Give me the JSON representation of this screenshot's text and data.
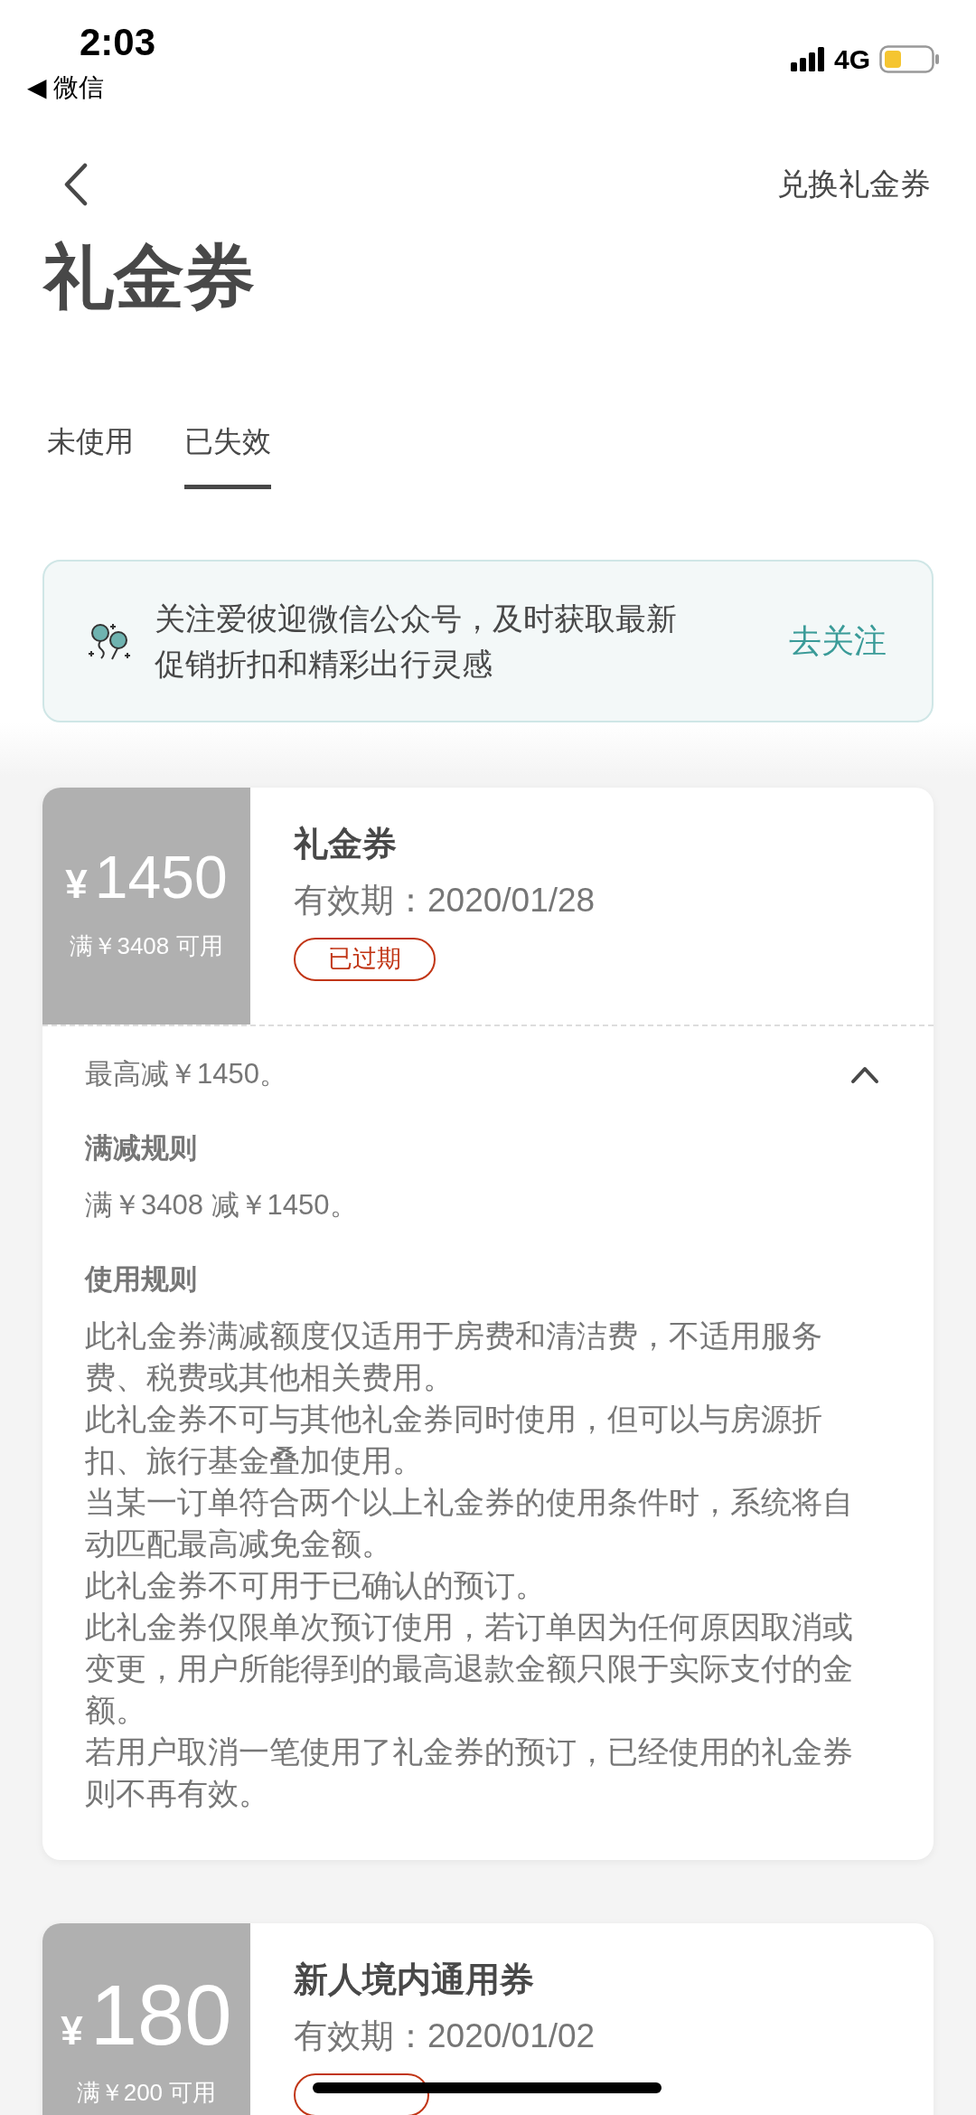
{
  "status_bar": {
    "time": "2:03",
    "back_app": "◀ 微信",
    "network": "4G"
  },
  "nav": {
    "action": "兑换礼金券"
  },
  "title": "礼金券",
  "tabs": [
    {
      "label": "未使用",
      "selected": false
    },
    {
      "label": "已失效",
      "selected": true
    }
  ],
  "banner": {
    "text": "关注爱彼迎微信公众号，及时获取最新促销折扣和精彩出行灵感",
    "action": "去关注"
  },
  "coupons": [
    {
      "currency": "¥",
      "amount": "1450",
      "condition": "满￥3408 可用",
      "title": "礼金券",
      "validity": "有效期：2020/01/28",
      "expired": true,
      "tag": "已过期",
      "expanded": true,
      "summary": "最高减￥1450。",
      "sections": [
        {
          "heading": "满减规则",
          "lines": [
            "满￥3408 减￥1450。"
          ]
        },
        {
          "heading": "使用规则",
          "lines": [
            "此礼金券满减额度仅适用于房费和清洁费，不适用服务费、税费或其他相关费用。",
            "此礼金券不可与其他礼金券同时使用，但可以与房源折扣、旅行基金叠加使用。",
            "当某一订单符合两个以上礼金券的使用条件时，系统将自动匹配最高减免金额。",
            "此礼金券不可用于已确认的预订。",
            "此礼金券仅限单次预订使用，若订单因为任何原因取消或变更，用户所能得到的最高退款金额只限于实际支付的金额。",
            "若用户取消一笔使用了礼金券的预订，已经使用的礼金券则不再有效。"
          ]
        }
      ]
    },
    {
      "currency": "¥",
      "amount": "180",
      "condition": "满￥200 可用",
      "title": "新人境内通用券",
      "validity": "有效期：2020/01/02",
      "expired": true
    }
  ]
}
